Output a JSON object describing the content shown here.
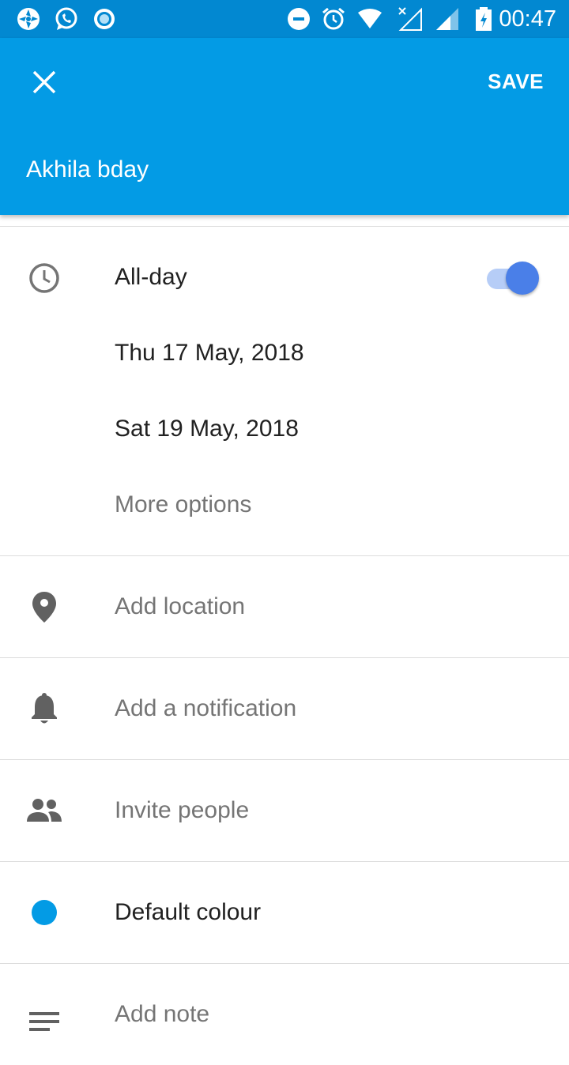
{
  "status_bar": {
    "time": "00:47",
    "left_icons": [
      "aperture-icon",
      "whatsapp-icon",
      "record-icon"
    ],
    "right_icons": [
      "do-not-disturb-icon",
      "alarm-icon",
      "wifi-icon",
      "no-data-signal-icon",
      "cell-signal-icon",
      "battery-charging-icon"
    ]
  },
  "app_bar": {
    "close_icon": "close-icon",
    "save_label": "SAVE",
    "event_title": "Akhila bday",
    "color": "#039be5"
  },
  "schedule": {
    "all_day_label": "All-day",
    "all_day_on": true,
    "start_date": "Thu 17 May, 2018",
    "end_date": "Sat 19 May, 2018",
    "more_options": "More options"
  },
  "rows": {
    "location": "Add location",
    "notification": "Add a notification",
    "invite": "Invite people",
    "colour": "Default colour",
    "note": "Add note"
  },
  "colors": {
    "status_bar": "#0288d1",
    "app_bar": "#039be5",
    "toggle_thumb": "#4a7fe8",
    "default_colour": "#039be5"
  }
}
